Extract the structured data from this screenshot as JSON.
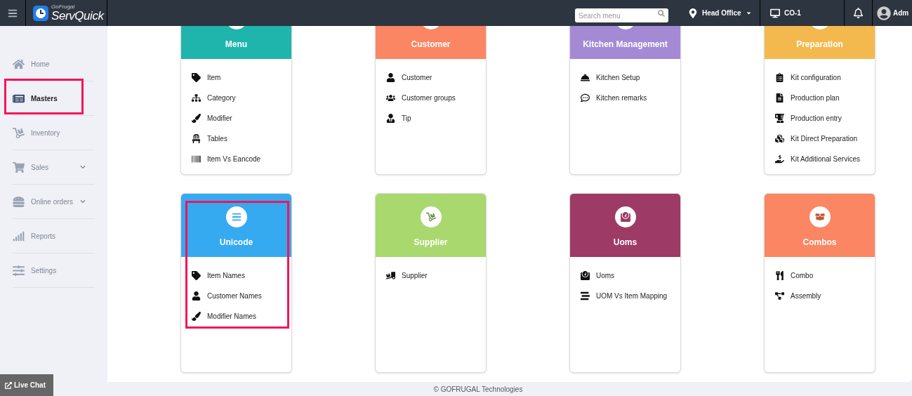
{
  "topbar": {
    "logo": {
      "brand": "GoFrugal",
      "product": "ServQuick"
    },
    "search": {
      "placeholder": "Search menu"
    },
    "location": "Head Office",
    "counter": "CO-1",
    "user": "Adm"
  },
  "sidebar": {
    "items": [
      {
        "label": "Home",
        "selected": false,
        "highlighted": false
      },
      {
        "label": "Masters",
        "selected": true,
        "highlighted": true
      },
      {
        "label": "Inventory",
        "selected": false,
        "highlighted": false
      },
      {
        "label": "Sales",
        "selected": false,
        "highlighted": false,
        "expanded": false
      },
      {
        "label": "Online orders",
        "selected": false,
        "highlighted": false,
        "expanded": false
      },
      {
        "label": "Reports",
        "selected": false,
        "highlighted": false
      },
      {
        "label": "Settings",
        "selected": false,
        "highlighted": false
      }
    ]
  },
  "cards": [
    {
      "title": "Menu",
      "color": "#1fb5ac",
      "highlighted": false,
      "items": [
        "Item",
        "Category",
        "Modifier",
        "Tables",
        "Item Vs Eancode"
      ]
    },
    {
      "title": "Customer",
      "color": "#fa8664",
      "highlighted": false,
      "items": [
        "Customer",
        "Customer groups",
        "Tip"
      ]
    },
    {
      "title": "Kitchen Management",
      "color": "#a48ad4",
      "highlighted": false,
      "items": [
        "Kitchen Setup",
        "Kitchen remarks"
      ]
    },
    {
      "title": "Preparation",
      "color": "#f3b94f",
      "highlighted": false,
      "items": [
        "Kit configuration",
        "Production plan",
        "Production entry",
        "Kit Direct Preparation",
        "Kit Additional Services"
      ]
    },
    {
      "title": "Unicode",
      "color": "#35aaf0",
      "highlighted": true,
      "items": [
        "Item Names",
        "Customer Names",
        "Modifier Names"
      ]
    },
    {
      "title": "Supplier",
      "color": "#a9d86e",
      "highlighted": false,
      "items": [
        "Supplier"
      ]
    },
    {
      "title": "Uoms",
      "color": "#9d3a65",
      "highlighted": false,
      "items": [
        "Uoms",
        "UOM Vs Item Mapping"
      ]
    },
    {
      "title": "Combos",
      "color": "#fa8664",
      "highlighted": false,
      "items": [
        "Combo",
        "Assembly"
      ]
    }
  ],
  "footer": "© GOFRUGAL Technologies",
  "live_chat": "Live Chat"
}
